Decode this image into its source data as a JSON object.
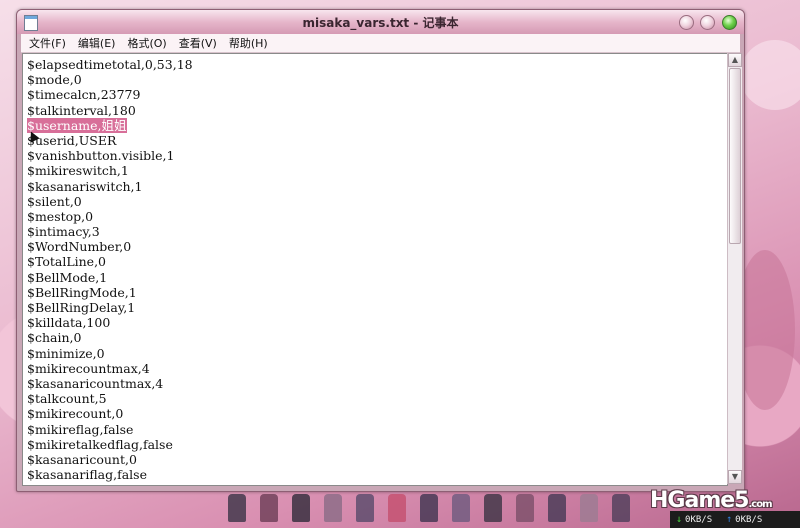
{
  "window": {
    "title": "misaka_vars.txt - 记事本"
  },
  "menu": [
    {
      "label": "文件(F)"
    },
    {
      "label": "编辑(E)"
    },
    {
      "label": "格式(O)"
    },
    {
      "label": "查看(V)"
    },
    {
      "label": "帮助(H)"
    }
  ],
  "editor": {
    "lines": [
      "$elapsedtimetotal,0,53,18",
      "$mode,0",
      "$timecalcn,23779",
      "$talkinterval,180",
      "$username,姐姐",
      "$userid,USER",
      "$vanishbutton.visible,1",
      "$mikireswitch,1",
      "$kasanariswitch,1",
      "$silent,0",
      "$mestop,0",
      "$intimacy,3",
      "$WordNumber,0",
      "$TotalLine,0",
      "$BellMode,1",
      "$BellRingMode,1",
      "$BellRingDelay,1",
      "$killdata,100",
      "$chain,0",
      "$minimize,0",
      "$mikirecountmax,4",
      "$kasanaricountmax,4",
      "$talkcount,5",
      "$mikirecount,0",
      "$mikireflag,false",
      "$mikiretalkedflag,false",
      "$kasanaricount,0",
      "$kasanariflag,false"
    ],
    "selected_line_index": 4
  },
  "watermark": {
    "text": "HGame5",
    "suffix": ".com"
  },
  "network": {
    "download": "0KB/S",
    "upload": "0KB/S"
  },
  "icons": {
    "app": "notepad-icon",
    "minimize": "minimize-icon",
    "maximize": "maximize-icon",
    "close": "close-icon"
  }
}
